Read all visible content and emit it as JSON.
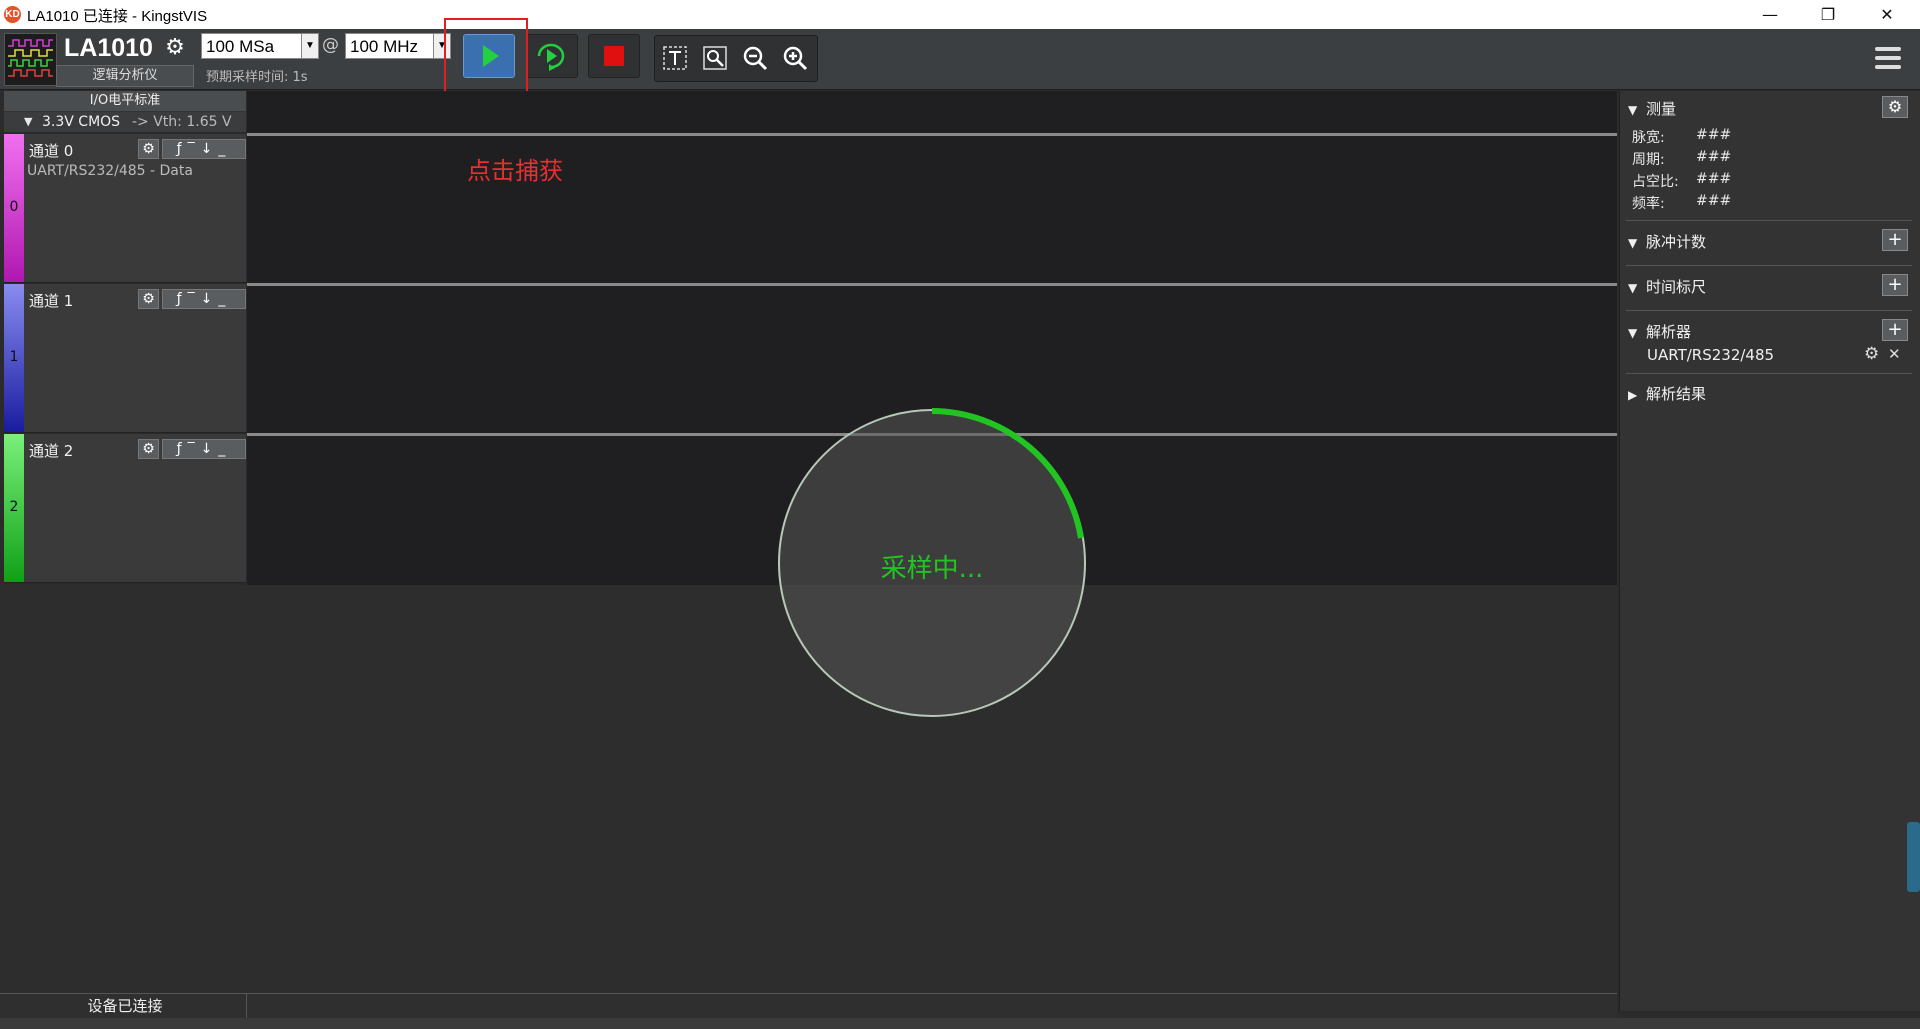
{
  "window": {
    "logo_text": "KD",
    "title": "LA1010 已连接 - KingstVIS",
    "minimize": "—",
    "restore": "❐",
    "close": "✕"
  },
  "toolbar": {
    "device_name": "LA1010",
    "device_subtitle": "逻辑分析仪",
    "sample_rate": "100 MSa",
    "at_sign": "@",
    "sample_freq": "100 MHz",
    "sample_time": "预期采样时间: 1s",
    "gear_glyph": "⚙"
  },
  "io": {
    "header": "I/O电平标准",
    "level": "3.3V CMOS",
    "vth": "-> Vth: 1.65 V"
  },
  "channels": [
    {
      "num": "0",
      "name": "通道 0",
      "subtitle": "UART/RS232/485 - Data",
      "color": "#c21fbf"
    },
    {
      "num": "1",
      "name": "通道 1",
      "subtitle": "",
      "color": "#2c2fb8"
    },
    {
      "num": "2",
      "name": "通道 2",
      "subtitle": "",
      "color": "#1fbd2a"
    }
  ],
  "channel_controls": {
    "gear": "⚙",
    "triggers": "ƒ‾↓_"
  },
  "annotation": {
    "note": "点击捕获"
  },
  "spinner": {
    "text": "采样中...",
    "color": "#22c422"
  },
  "right_panel": {
    "measure": {
      "title": "测量",
      "items": [
        {
          "label": "脉宽:",
          "value": "###"
        },
        {
          "label": "周期:",
          "value": "###"
        },
        {
          "label": "占空比:",
          "value": "###"
        },
        {
          "label": "频率:",
          "value": "###"
        }
      ]
    },
    "pulse_count": {
      "title": "脉冲计数"
    },
    "time_ruler": {
      "title": "时间标尺"
    },
    "analyzer": {
      "title": "解析器",
      "item": "UART/RS232/485"
    },
    "results": {
      "title": "解析结果"
    },
    "plus": "+",
    "gear": "⚙",
    "remove": "✕",
    "expanded": "▼",
    "collapsed": "▶"
  },
  "status": {
    "text": "设备已连接"
  },
  "colors": {
    "highlight": "#e02020",
    "run_button": "#3a6fb0",
    "stop_red": "#e01010"
  }
}
